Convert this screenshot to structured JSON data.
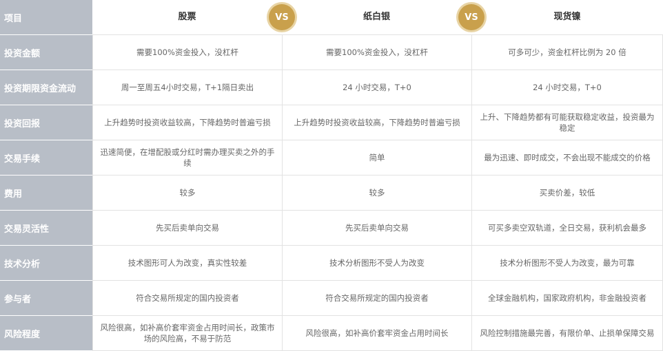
{
  "header": {
    "item_label": "项目",
    "col1": "股票",
    "col2": "纸白银",
    "col3": "现货镍",
    "vs": "VS"
  },
  "rows": [
    {
      "label": "投资金额",
      "c1": "需要100%资金投入，没杠杆",
      "c2": "需要100%资金投入，没杠杆",
      "c3": "可多可少，资金杠杆比例为 20 倍"
    },
    {
      "label": "投资期限资金流动",
      "c1": "周一至周五4小时交易，T+1隔日卖出",
      "c2": "24 小时交易，T+0",
      "c3": "24 小时交易，T+0"
    },
    {
      "label": "投资回报",
      "c1": "上升趋势时投资收益较高，下降趋势时普遍亏损",
      "c2": "上升趋势时投资收益较高，下降趋势时普遍亏损",
      "c3": "上升、下降趋势都有可能获取稳定收益，投资最为稳定"
    },
    {
      "label": "交易手续",
      "c1": "迅速简便，在增配股或分红时需办理买卖之外的手续",
      "c2": "简单",
      "c3": "最为迅速、即时成交，不会出现不能成交的价格"
    },
    {
      "label": "费用",
      "c1": "较多",
      "c2": "较多",
      "c3": "买卖价差，较低"
    },
    {
      "label": "交易灵活性",
      "c1": "先买后卖单向交易",
      "c2": "先买后卖单向交易",
      "c3": "可买多卖空双轨道，全日交易，获利机会最多"
    },
    {
      "label": "技术分析",
      "c1": "技术图形可人为改变，真实性较差",
      "c2": "技术分析图形不受人为改变",
      "c3": "技术分析图形不受人为改变，最为可靠"
    },
    {
      "label": "参与者",
      "c1": "符合交易所规定的国内投资者",
      "c2": "符合交易所规定的国内投资者",
      "c3": "全球金融机构，国家政府机构，非金融投资者"
    },
    {
      "label": "风险程度",
      "c1": "风险很高，如补高价套牢资金占用时间长，政策市场的风险高，不易于防范",
      "c2": "风险很高，如补高价套牢资金占用时间长",
      "c3": "风险控制措施最完善，有限价单、止损单保障交易"
    }
  ],
  "colors": {
    "label_bg": "#b8bec7",
    "vs_bg": "#c9a04c",
    "vs_ring": "#e8d4a5",
    "cell_text": "#666666",
    "border": "#e2e2e2"
  }
}
